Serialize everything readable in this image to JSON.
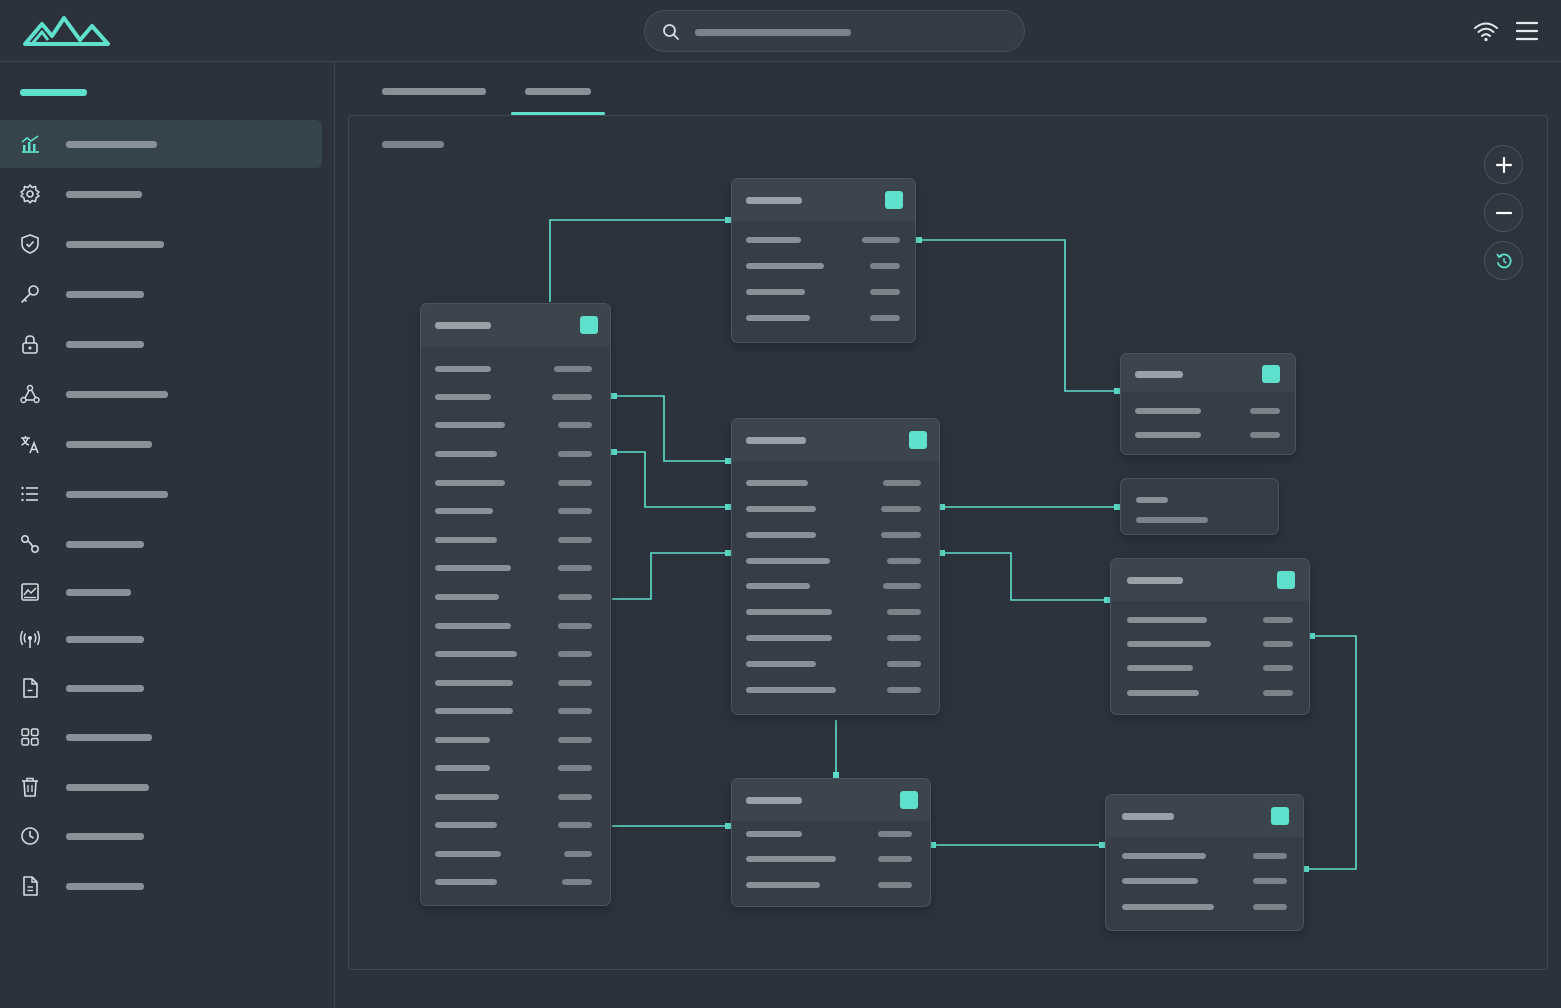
{
  "colors": {
    "background": "#2b323c",
    "accent": "#5fe0cc",
    "panel": "#363d47"
  },
  "search": {
    "placeholder": ""
  },
  "sidebar": {
    "heading": "",
    "items": [
      {
        "icon": "analytics-icon",
        "label": "",
        "active": true
      },
      {
        "icon": "gear-icon",
        "label": ""
      },
      {
        "icon": "shield-icon",
        "label": ""
      },
      {
        "icon": "key-icon",
        "label": ""
      },
      {
        "icon": "lock-icon",
        "label": ""
      },
      {
        "icon": "webhook-icon",
        "label": ""
      },
      {
        "icon": "translate-icon",
        "label": ""
      },
      {
        "icon": "list-icon",
        "label": ""
      },
      {
        "icon": "workflow-icon",
        "label": ""
      },
      {
        "icon": "image-chart-icon",
        "label": ""
      },
      {
        "icon": "broadcast-icon",
        "label": ""
      },
      {
        "icon": "file-icon",
        "label": ""
      },
      {
        "icon": "grid-icon",
        "label": ""
      },
      {
        "icon": "trash-icon",
        "label": ""
      },
      {
        "icon": "history-icon",
        "label": ""
      },
      {
        "icon": "document-icon",
        "label": ""
      }
    ]
  },
  "tabs": [
    {
      "label": "",
      "active": false
    },
    {
      "label": "",
      "active": true
    }
  ],
  "canvas": {
    "title": ""
  },
  "zoom_controls": [
    "plus-icon",
    "minus-icon",
    "reset-icon"
  ],
  "entities": [
    {
      "id": "a",
      "title": "",
      "rows": 19
    },
    {
      "id": "b",
      "title": "",
      "rows": 4
    },
    {
      "id": "c",
      "title": "",
      "rows": 9
    },
    {
      "id": "d",
      "title": "",
      "rows": 3
    },
    {
      "id": "e",
      "title": "",
      "rows": 2
    },
    {
      "id": "f",
      "title": "",
      "rows": 2
    },
    {
      "id": "g",
      "title": "",
      "rows": 4
    },
    {
      "id": "h",
      "title": "",
      "rows": 3
    }
  ]
}
